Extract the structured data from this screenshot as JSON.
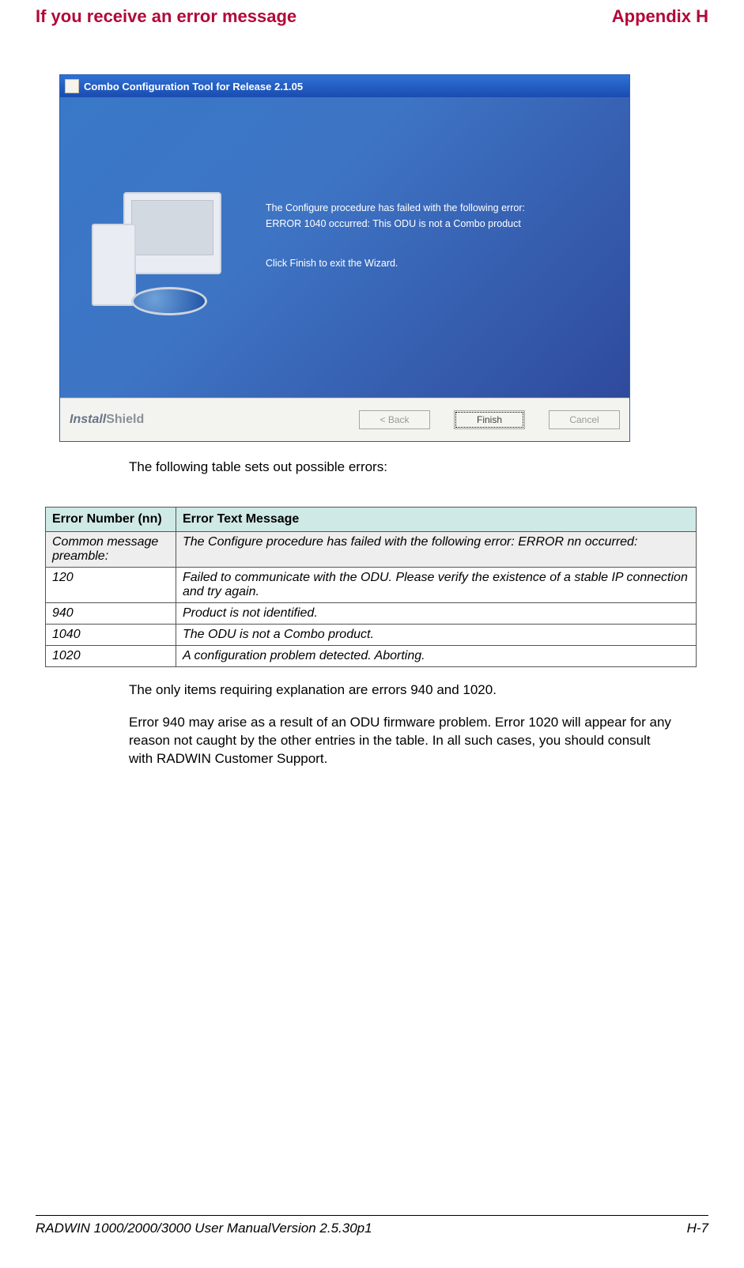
{
  "header": {
    "left": "If you receive an error message",
    "right": "Appendix H"
  },
  "wizard": {
    "title": "Combo Configuration Tool for Release 2.1.05",
    "msg_line1": "The Configure procedure has failed with the following error:",
    "msg_line2": "ERROR 1040 occurred: This ODU is not a Combo product",
    "msg_line3": "Click Finish to exit the Wizard.",
    "brand_a": "Install",
    "brand_b": "Shield",
    "back_btn": "<  Back",
    "finish_btn": "Finish",
    "cancel_btn": "Cancel"
  },
  "intro": "The following table sets out possible errors:",
  "table": {
    "head_num": "Error Number (nn)",
    "head_msg": "Error Text Message",
    "rows": [
      {
        "num": "Common message preamble:",
        "msg": "The Configure procedure has failed with the following error: ERROR nn occurred:"
      },
      {
        "num": "120",
        "msg": "Failed to communicate with the ODU. Please verify the existence of a stable IP connection and try again."
      },
      {
        "num": "940",
        "msg": "Product is not identified."
      },
      {
        "num": "1040",
        "msg": "The ODU is not a Combo product."
      },
      {
        "num": "1020",
        "msg": "A configuration problem detected. Aborting."
      }
    ]
  },
  "para1": "The only items requiring explanation are errors 940 and 1020.",
  "para2": "Error 940 may arise as a result of an ODU firmware problem. Error 1020 will appear for any reason not caught by the other entries in the table. In all such cases, you should consult with RADWIN Customer Support.",
  "footer": {
    "left": "RADWIN 1000/2000/3000 User ManualVersion  2.5.30p1",
    "right": "H-7"
  }
}
